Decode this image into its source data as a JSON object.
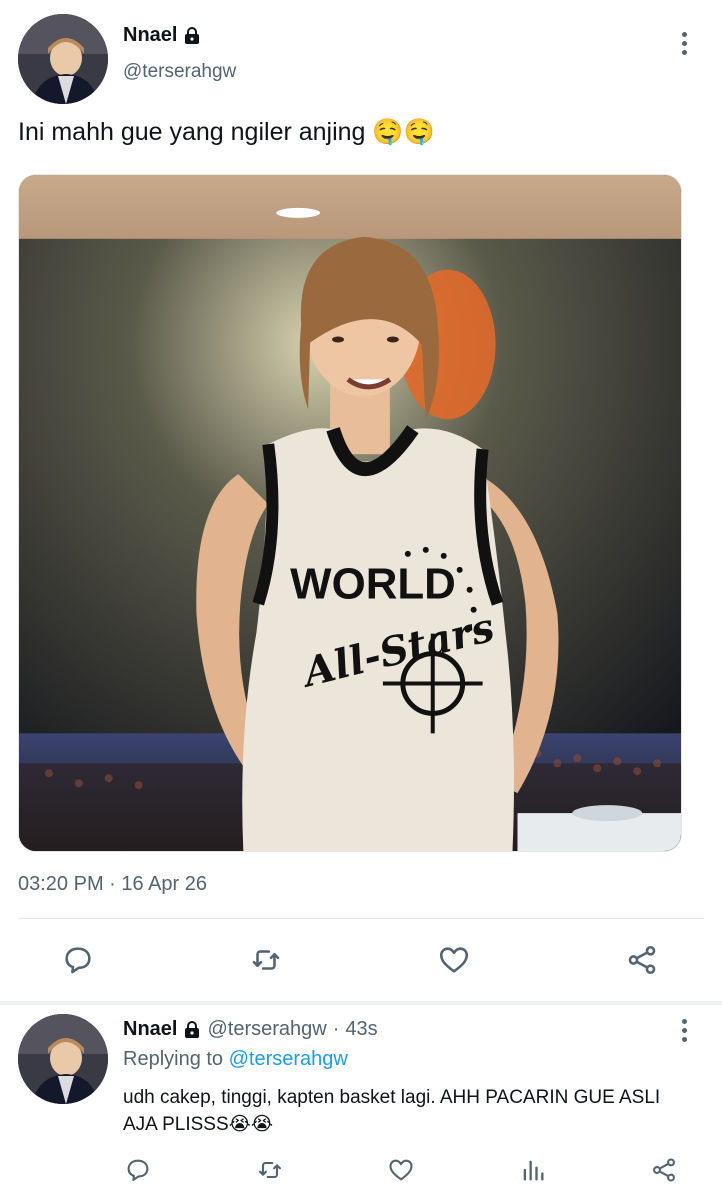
{
  "tweet": {
    "author_name": "Nnael",
    "author_handle": "@terserahgw",
    "text": "Ini mahh gue yang ngiler anjing 🤤🤤",
    "media": {
      "jersey_text_top": "WORLD",
      "jersey_text_script": "All-Stars"
    },
    "timestamp": "03:20 PM · 16 Apr 26"
  },
  "reply": {
    "author_name": "Nnael",
    "author_handle": "@terserahgw",
    "age": "43s",
    "separator": "·",
    "replying_prefix": "Replying to",
    "replying_to": "@terserahgw",
    "text": "udh cakep, tinggi, kapten basket lagi. AHH PACARIN GUE ASLI AJA PLISSS😭😭"
  },
  "icons": {
    "lock": "lock-icon",
    "more": "more-vertical-icon",
    "reply": "reply-icon",
    "retweet": "retweet-icon",
    "like": "heart-icon",
    "share": "share-icon",
    "analytics": "analytics-icon"
  },
  "colors": {
    "text_primary": "#0f1419",
    "text_secondary": "#536471",
    "link": "#1d9bf0",
    "divider": "#e5e8eb"
  }
}
